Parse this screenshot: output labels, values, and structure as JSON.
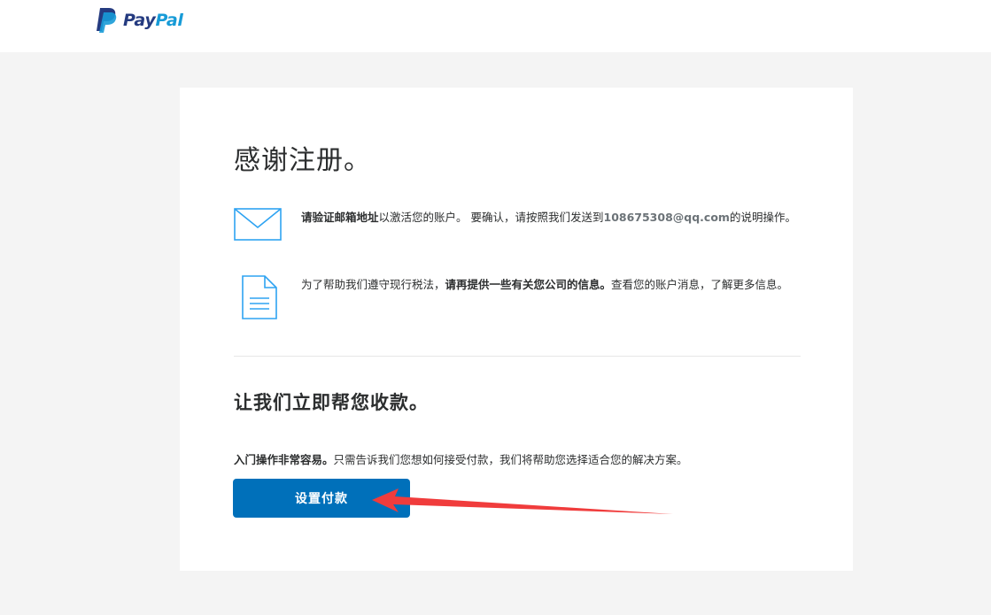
{
  "header": {
    "logo_pay": "Pay",
    "logo_pal": "Pal"
  },
  "card": {
    "title": "感谢注册。",
    "verify": {
      "bold": "请验证邮箱地址",
      "text": "以激活您的账户。 要确认，请按照我们发送到",
      "email": "108675308@qq.com",
      "tail": "的说明操作。"
    },
    "tax": {
      "prefix": "为了帮助我们遵守现行税法，",
      "bold": "请再提供一些有关您公司的信息。",
      "tail": "查看您的账户消息，了解更多信息。"
    },
    "subtitle": "让我们立即帮您收款。",
    "intro": {
      "bold": "入门操作非常容易。",
      "text": "只需告诉我们您想如何接受付款，我们将帮助您选择适合您的解决方案。"
    },
    "setup_button": "设置付款"
  },
  "colors": {
    "brand_dark": "#253b80",
    "brand_light": "#179bd7",
    "button": "#0070ba",
    "icon": "#2ea3f2",
    "annotation_arrow": "#f03c3c"
  }
}
